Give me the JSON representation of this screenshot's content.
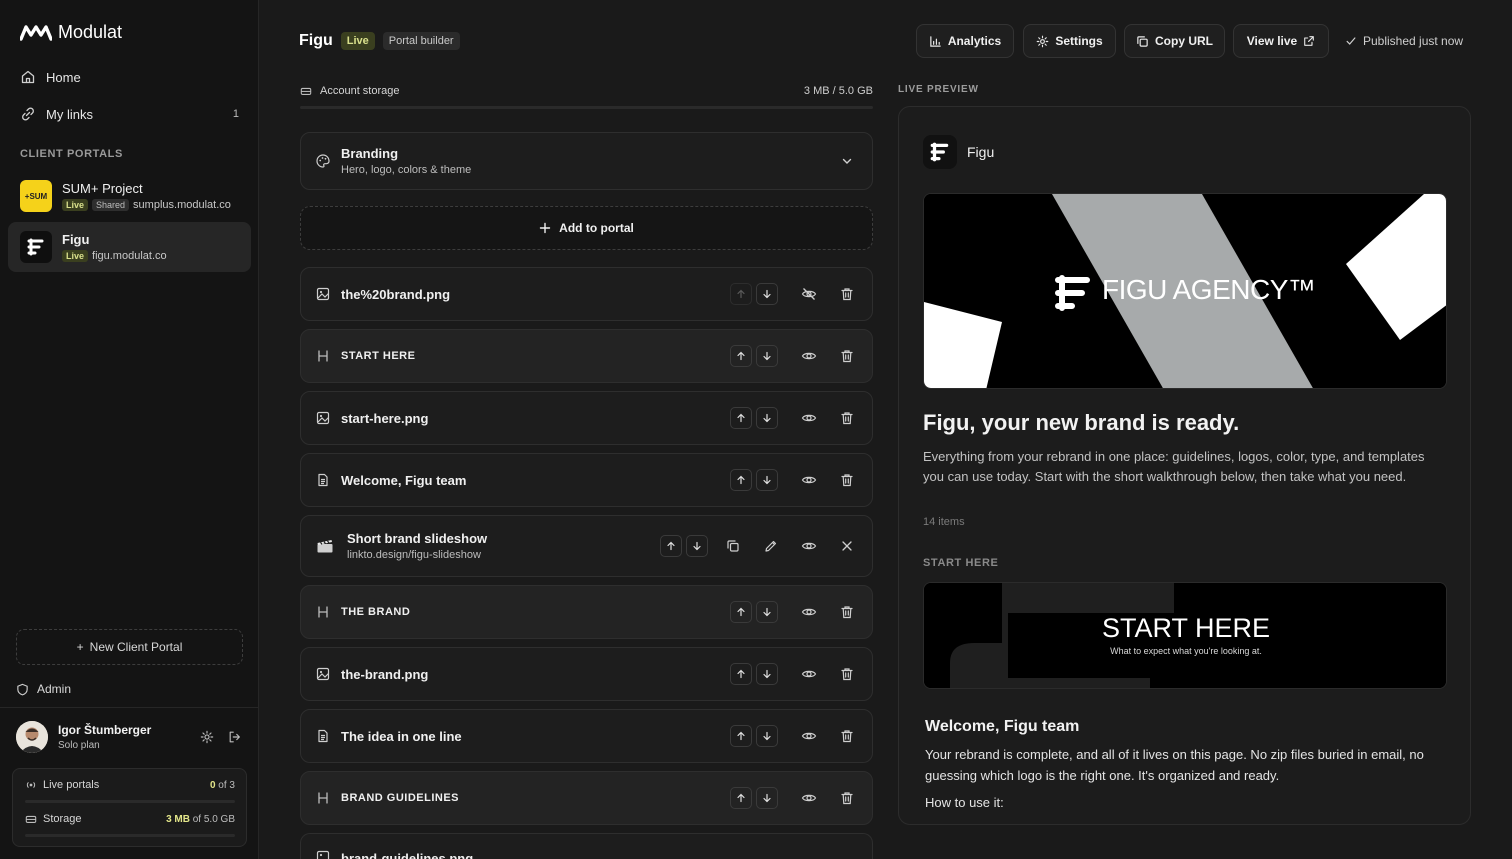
{
  "app": {
    "name": "Modulat"
  },
  "colors": {
    "accent_live_bg": "#3a3f1f",
    "accent_live_text": "#d9e08c",
    "sum_thumb": "#f5d21a",
    "sidebar_bg": "#141414",
    "main_bg": "#1a1a1a"
  },
  "nav": [
    {
      "label": "Home",
      "icon": "home-icon",
      "count": ""
    },
    {
      "label": "My links",
      "icon": "link-icon",
      "count": "1"
    }
  ],
  "sidebar": {
    "section_label": "CLIENT PORTALS",
    "portals": [
      {
        "name": "SUM+ Project",
        "live": "Live",
        "shared": "Shared",
        "domain": "sumplus.modulat.co",
        "thumb_text": "+SUM"
      },
      {
        "name": "Figu",
        "live": "Live",
        "domain": "figu.modulat.co"
      }
    ],
    "new_portal": "New Client Portal",
    "admin": "Admin"
  },
  "user": {
    "name": "Igor Štumberger",
    "plan": "Solo plan"
  },
  "stats": {
    "live_portals_label": "Live portals",
    "live_portals_used": "0",
    "live_portals_total": " of 3",
    "storage_label": "Storage",
    "storage_used": "3 MB",
    "storage_total": " of 5.0 GB"
  },
  "header": {
    "title": "Figu",
    "live": "Live",
    "builder": "Portal builder",
    "buttons": {
      "analytics": "Analytics",
      "settings": "Settings",
      "copy_url": "Copy URL",
      "view_live": "View live"
    },
    "published": "Published just now"
  },
  "storage": {
    "label": "Account storage",
    "value": "3 MB / 5.0 GB"
  },
  "branding": {
    "title": "Branding",
    "subtitle": "Hero, logo, colors & theme"
  },
  "add_to_portal": "Add to portal",
  "items": [
    {
      "title": "the%20brand.png",
      "type": "image"
    },
    {
      "title": "START HERE",
      "type": "heading"
    },
    {
      "title": "start-here.png",
      "type": "image"
    },
    {
      "title": "Welcome, Figu team",
      "type": "text"
    },
    {
      "title": "Short brand slideshow",
      "subtitle": "linkto.design/figu-slideshow",
      "type": "link"
    },
    {
      "title": "THE BRAND",
      "type": "heading"
    },
    {
      "title": "the-brand.png",
      "type": "image"
    },
    {
      "title": "The idea in one line",
      "type": "text"
    },
    {
      "title": "BRAND GUIDELINES",
      "type": "heading"
    },
    {
      "title": "brand-guidelines.png",
      "type": "image"
    }
  ],
  "preview": {
    "label": "LIVE PREVIEW",
    "brand": "Figu",
    "hero_text": "FIGU AGENCY™",
    "headline": "Figu, your new brand is ready.",
    "intro": "Everything from your rebrand in one place: guidelines, logos, color, type, and templates you can use today. Start with the short walkthrough below, then take what you need.",
    "count": "14 items",
    "section": "START HERE",
    "start_title": "START HERE",
    "start_sub": "What to expect what you're looking at.",
    "welcome_title": "Welcome, Figu team",
    "welcome_body": "Your rebrand is complete, and all of it lives on this page. No zip files buried in email, no guessing which logo is the right one. It's organized and ready.",
    "how_to": "How to use it:"
  }
}
